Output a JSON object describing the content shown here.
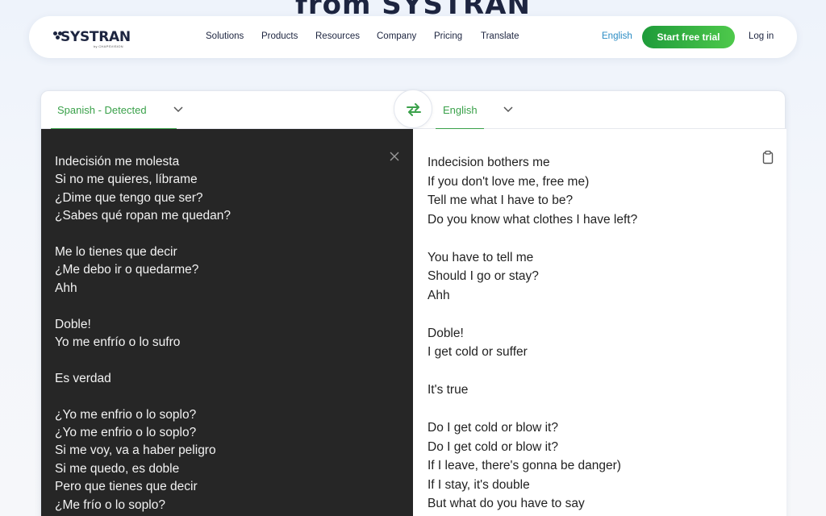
{
  "hero": {
    "peek_text": "from SYSTRAN"
  },
  "brand": {
    "name": "SYSTRAN",
    "sub": "by CHAPSVISION"
  },
  "nav": {
    "links": [
      "Solutions",
      "Products",
      "Resources",
      "Company",
      "Pricing",
      "Translate"
    ],
    "language": "English",
    "cta": "Start free trial",
    "login": "Log in"
  },
  "translator": {
    "source_lang": "Spanish - Detected",
    "target_lang": "English",
    "source_lines": [
      "Indecisión me molesta",
      "Si no me quieres, líbrame",
      "¿Dime que tengo que ser?",
      "¿Sabes qué ropan me quedan?",
      "",
      "Me lo tienes que decir",
      "¿Me debo ir o quedarme?",
      "Ahh",
      "",
      "Doble!",
      "Yo me enfrío o lo sufro",
      "",
      "Es verdad",
      "",
      "¿Yo me enfrio o lo soplo?",
      "¿Yo me enfrio o lo soplo?",
      "Si me voy, va a haber peligro",
      "Si me quedo, es doble",
      "Pero que tienes que decir",
      "¿Me frío o lo soplo?"
    ],
    "target_lines": [
      "Indecision bothers me",
      "If you don't love me, free me)",
      "Tell me what I have to be?",
      "Do you know what clothes I have left?",
      "",
      "You have to tell me",
      "Should I go or stay?",
      "Ahh",
      "",
      "Doble!",
      "I get cold or suffer",
      "",
      "It's true",
      "",
      "Do I get cold or blow it?",
      "Do I get cold or blow it?",
      "If I leave, there's gonna be danger)",
      "If I stay, it's double",
      "But what do you have to say"
    ]
  },
  "colors": {
    "accent_green": "#3aa14a",
    "brand_navy": "#1d2540",
    "source_bg": "#262626",
    "link_blue": "#2a8cc4"
  },
  "icons": {
    "swap": "swap-arrows-icon",
    "close": "close-icon",
    "copy": "clipboard-icon",
    "chevron": "chevron-down-icon"
  }
}
